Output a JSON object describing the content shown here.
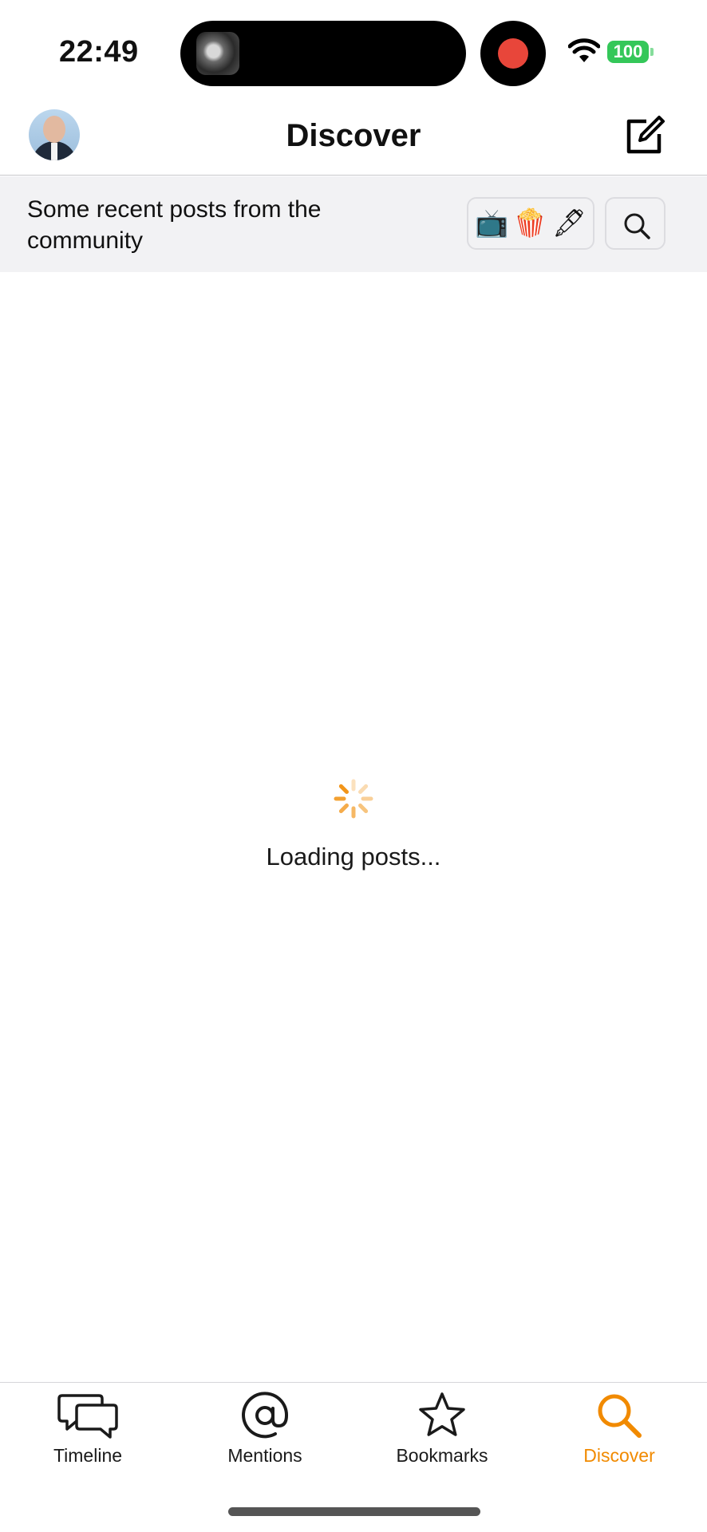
{
  "status_bar": {
    "time": "22:49",
    "battery": "100",
    "icons": [
      "wifi-icon",
      "battery-icon",
      "screen-record-icon"
    ]
  },
  "nav": {
    "title": "Discover",
    "icons": [
      "avatar",
      "compose-icon"
    ]
  },
  "header": {
    "description": "Some recent posts from the community",
    "emoji_filters": [
      "📺",
      "🍿",
      "🖋"
    ],
    "search_icon": "search-icon"
  },
  "content": {
    "loading_text": "Loading posts..."
  },
  "tabs": [
    {
      "label": "Timeline",
      "icon": "chat-bubbles-icon"
    },
    {
      "label": "Mentions",
      "icon": "at-sign-icon"
    },
    {
      "label": "Bookmarks",
      "icon": "star-icon"
    },
    {
      "label": "Discover",
      "icon": "magnifier-icon",
      "active": true
    }
  ],
  "colors": {
    "accent": "#f18a00",
    "strip_bg": "#f2f2f4",
    "battery": "#34c759",
    "record": "#e8463a"
  }
}
